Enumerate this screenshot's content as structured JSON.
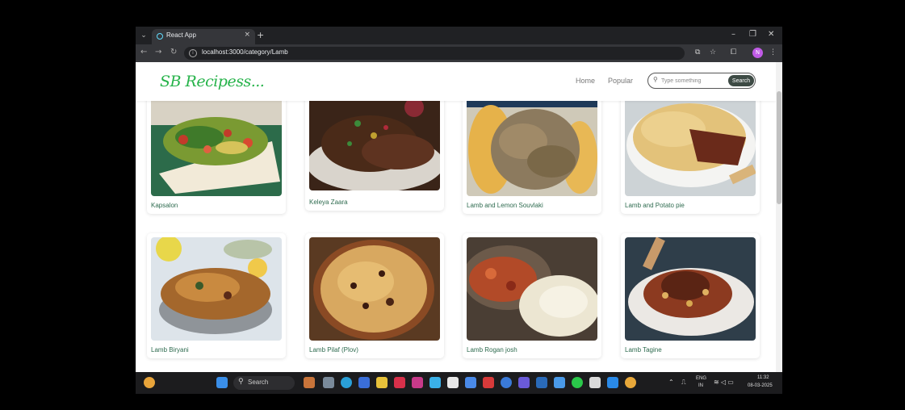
{
  "browser": {
    "tab_title": "React App",
    "url": "localhost:3000/category/Lamb"
  },
  "site": {
    "logo": "SB Recipess...",
    "nav": {
      "home": "Home",
      "popular": "Popular"
    },
    "search": {
      "placeholder": "Type something",
      "button": "Search"
    }
  },
  "recipes": [
    {
      "title": "Kapsalon"
    },
    {
      "title": "Keleya Zaara"
    },
    {
      "title": "Lamb and Lemon Souvlaki"
    },
    {
      "title": "Lamb and Potato pie"
    },
    {
      "title": "Lamb Biryani"
    },
    {
      "title": "Lamb Pilaf (Plov)"
    },
    {
      "title": "Lamb Rogan josh"
    },
    {
      "title": "Lamb Tagine"
    }
  ],
  "taskbar": {
    "search_label": "Search",
    "language": "ENG",
    "region": "IN",
    "time": "11:32",
    "date": "08-03-2025"
  }
}
